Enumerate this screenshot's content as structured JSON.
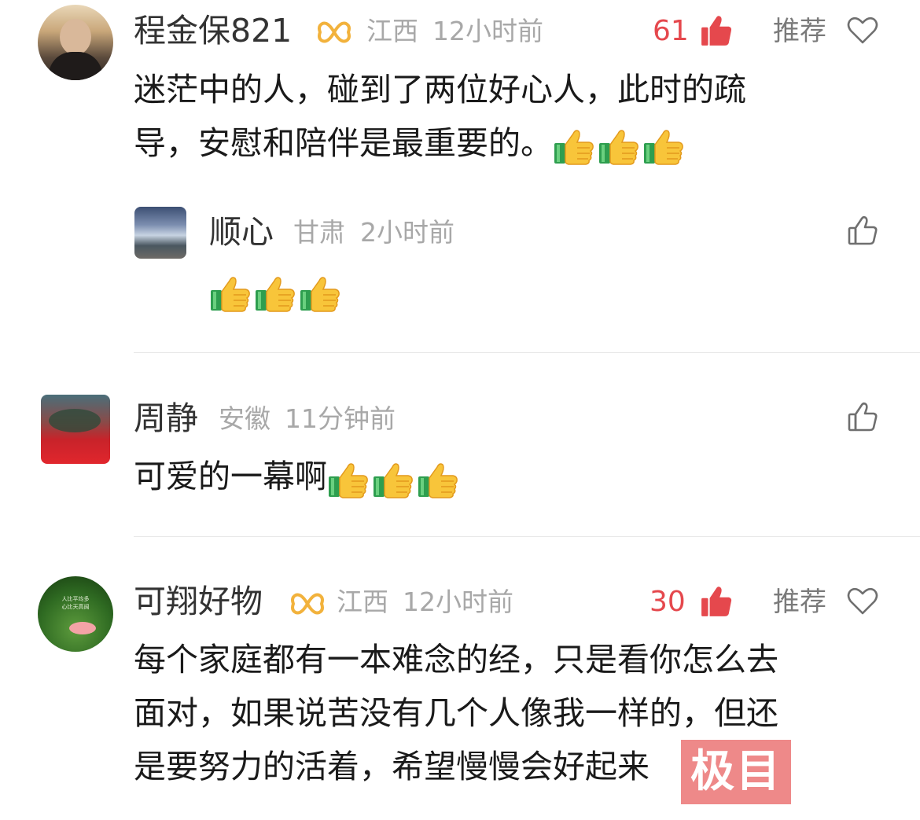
{
  "comments": [
    {
      "username": "程金保821",
      "location": "江西",
      "time": "12小时前",
      "likes": "61",
      "recommend_label": "推荐",
      "text_lines": [
        "迷茫中的人，碰到了两位好心人，此时的疏",
        "导，安慰和陪伴是最重要的。"
      ],
      "reply": {
        "username": "顺心",
        "location": "甘肃",
        "time": "2小时前"
      }
    },
    {
      "username": "周静",
      "location": "安徽",
      "time": "11分钟前",
      "text_lines": [
        "可爱的一幕啊"
      ]
    },
    {
      "username": "可翔好物",
      "location": "江西",
      "time": "12小时前",
      "likes": "30",
      "recommend_label": "推荐",
      "avatar_text": [
        "人比平均多",
        "心比天高阔"
      ],
      "text_lines": [
        "每个家庭都有一本难念的经，只是看你怎么去",
        "面对，如果说苦没有几个人像我一样的，但还",
        "是要努力的活着，希望慢慢会好起来"
      ]
    }
  ],
  "watermark": "极目",
  "colors": {
    "like_red": "#e5484d",
    "meta_gray": "#a8a8a8",
    "badge_gold": "#f2b23c",
    "watermark_red": "#e85c5c"
  },
  "icons": {
    "like_filled": "thumbs-up-filled-icon",
    "like_outline": "thumbs-up-outline-icon",
    "heart": "heart-outline-icon",
    "badge": "vip-infinity-badge-icon",
    "emoji": "thumbs-up-emoji-icon"
  }
}
